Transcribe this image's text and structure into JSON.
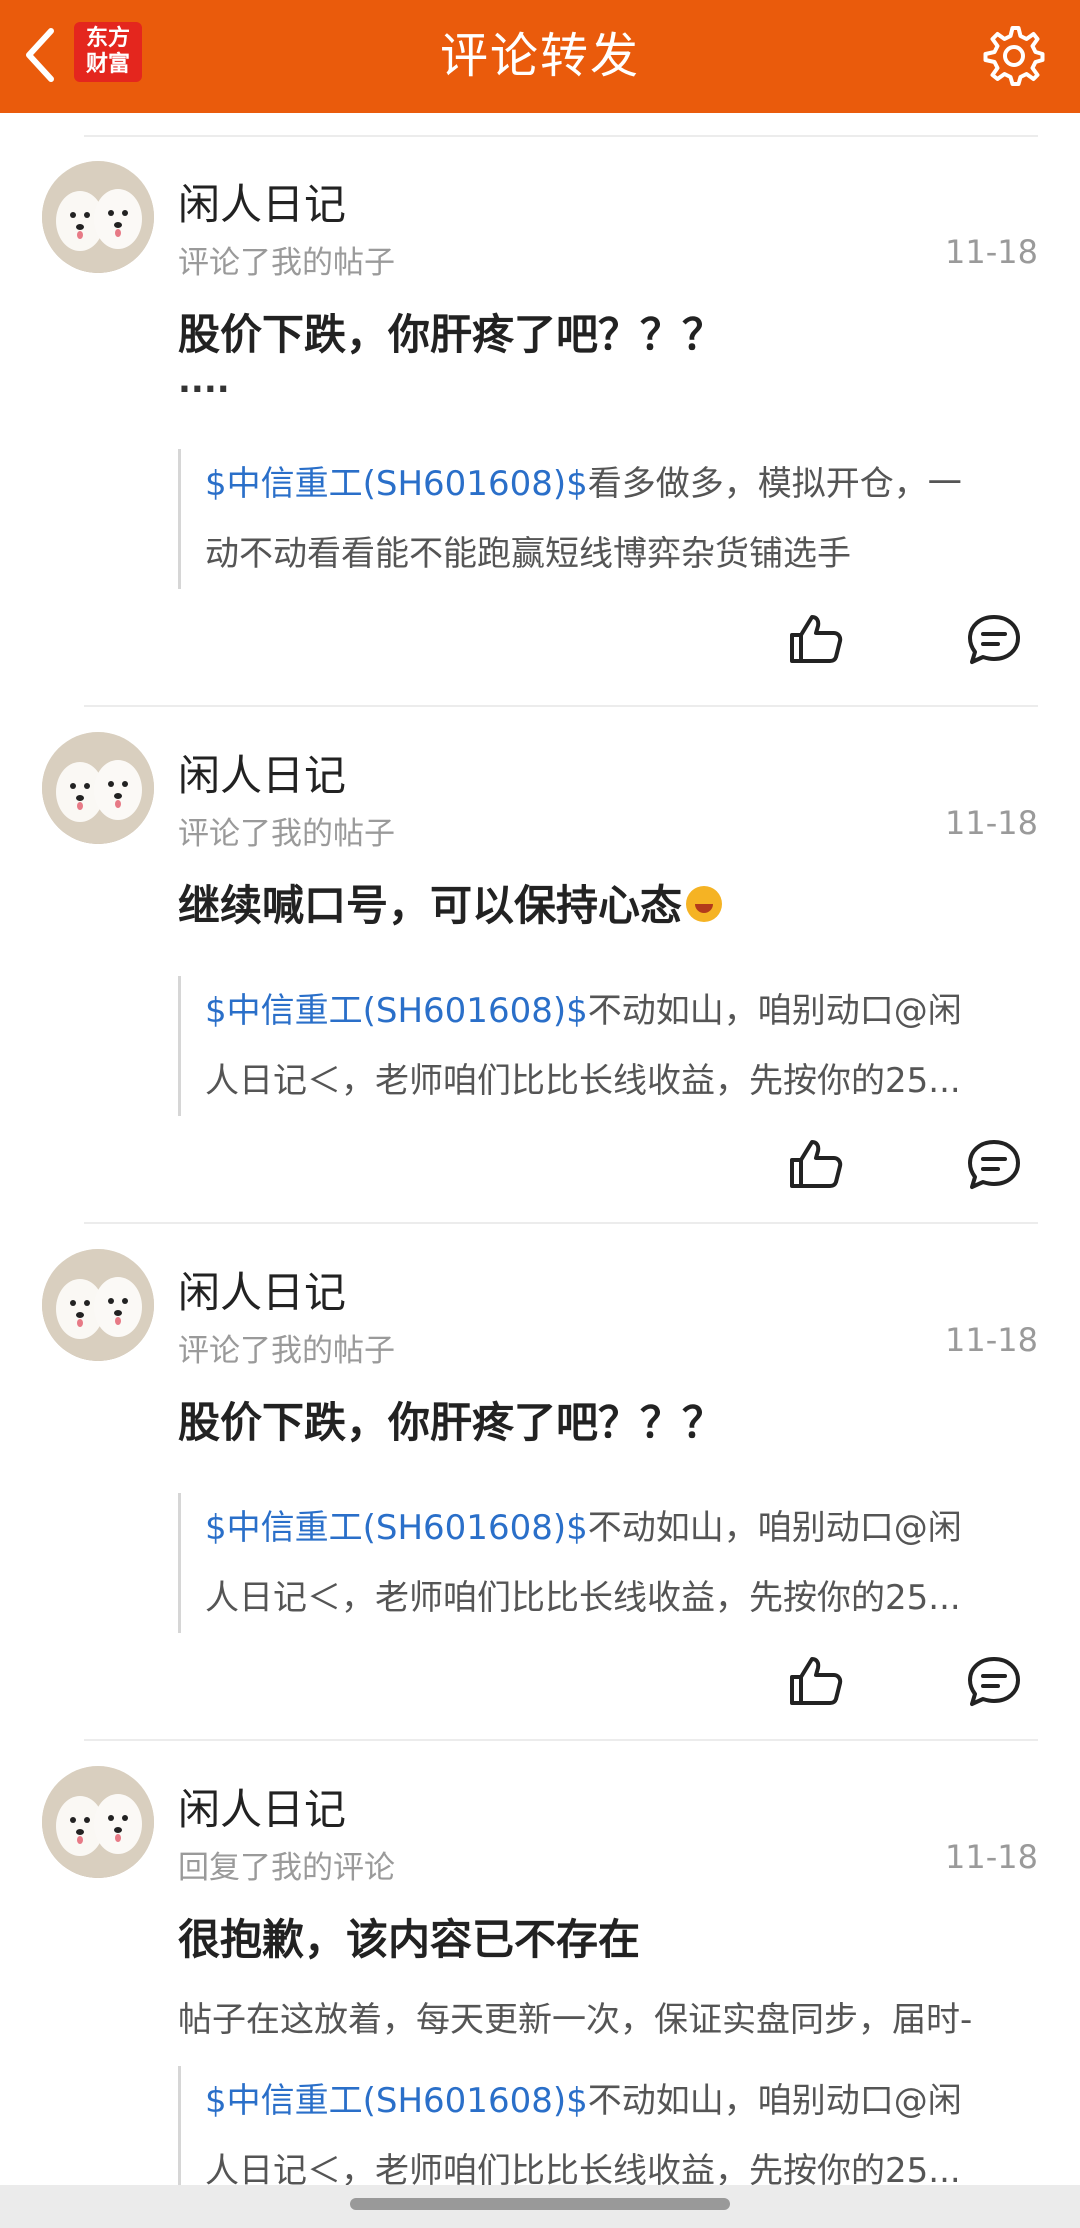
{
  "header": {
    "title": "评论转发",
    "logo_line1": "东方",
    "logo_line2": "财富",
    "back_icon": "chevron-left-icon",
    "settings_icon": "gear-icon"
  },
  "colors": {
    "header_bg": "#ea5b0c",
    "link": "#2a6fc9",
    "muted": "#9a9a9a"
  },
  "items": [
    {
      "user_name": "闲人日记",
      "action": "评论了我的帖子",
      "date": "11-18",
      "comment": "股价下跌，你肝疼了吧？？？",
      "comment_extra": "....",
      "quote_link": "$中信重工(SH601608)$",
      "quote_line1_rest": "看多做多，模拟开仓，一",
      "quote_line2": "动不动看看能不能跑赢短线博弈杂货铺选手"
    },
    {
      "user_name": "闲人日记",
      "action": "评论了我的帖子",
      "date": "11-18",
      "comment": "继续喊口号，可以保持心态",
      "emoji": "laughing-emoji",
      "quote_link": "$中信重工(SH601608)$",
      "quote_line1_rest": "不动如山，咱别动口@闲",
      "quote_line2": "人日记＜，老师咱们比比长线收益，先按你的25..."
    },
    {
      "user_name": "闲人日记",
      "action": "评论了我的帖子",
      "date": "11-18",
      "comment": "股价下跌，你肝疼了吧？？？",
      "quote_link": "$中信重工(SH601608)$",
      "quote_line1_rest": "不动如山，咱别动口@闲",
      "quote_line2": "人日记＜，老师咱们比比长线收益，先按你的25..."
    },
    {
      "user_name": "闲人日记",
      "action": "回复了我的评论",
      "date": "11-18",
      "comment": " 很抱歉，该内容已不存在",
      "reply_text": "帖子在这放着，每天更新一次，保证实盘同步，届时-",
      "quote_link": "$中信重工(SH601608)$",
      "quote_line1_rest": "不动如山，咱别动口@闲",
      "quote_line2": "人日记＜，老师咱们比比长线收益，先按你的25..."
    }
  ]
}
